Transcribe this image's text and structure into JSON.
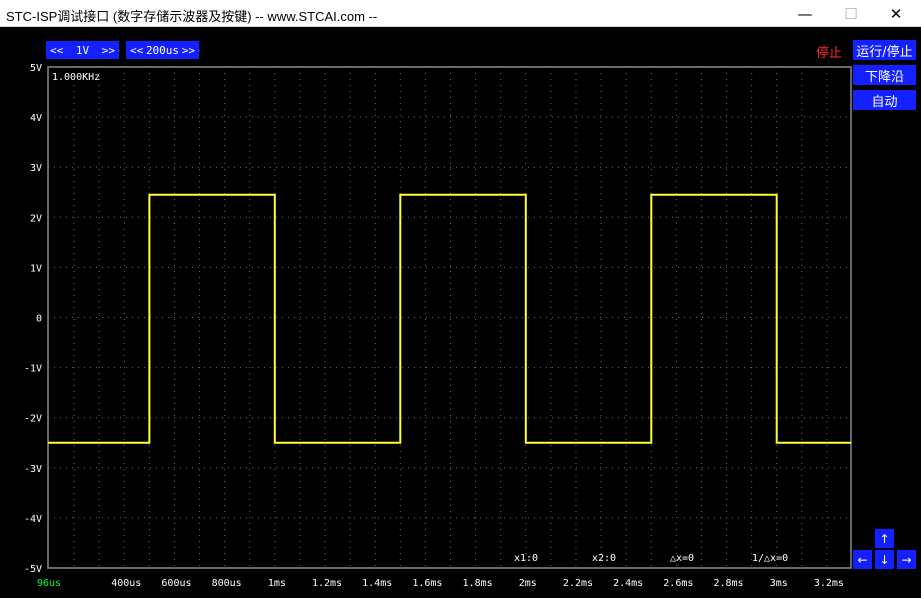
{
  "window": {
    "title": "STC-ISP调试接口 (数字存储示波器及按键) -- www.STCAI.com --",
    "minimize_icon": "minimize-icon",
    "maximize_icon": "maximize-icon",
    "close_icon": "close-icon"
  },
  "toolbar": {
    "volt_prev": "<<",
    "volt_value": "1V",
    "volt_next": ">>",
    "time_prev": "<<",
    "time_value": "200us",
    "time_next": ">>"
  },
  "status": {
    "state": "停止"
  },
  "side_buttons": {
    "run_stop": "运行/停止",
    "trigger_edge": "下降沿",
    "auto": "自动"
  },
  "arrows": {
    "up": "↑",
    "left": "←",
    "down": "↓",
    "right": "→"
  },
  "scope": {
    "frequency": "1.000KHz",
    "cursor_x1": "x1:0",
    "cursor_x2": "x2:0",
    "delta_x": "△x=0",
    "inv_delta_x": "1/△x=0",
    "x_start_label": "96us",
    "colors": {
      "trace": "#ffff33",
      "grid": "#6a6a6a",
      "border": "#8a8a8a",
      "start_label": "#00ff40"
    }
  },
  "chart_data": {
    "type": "line",
    "y_ticks": [
      "5V",
      "4V",
      "3V",
      "2V",
      "1V",
      "0",
      "-1V",
      "-2V",
      "-3V",
      "-4V",
      "-5V"
    ],
    "x_ticks": [
      "400us",
      "600us",
      "800us",
      "1ms",
      "1.2ms",
      "1.4ms",
      "1.6ms",
      "1.8ms",
      "2ms",
      "2.2ms",
      "2.4ms",
      "2.6ms",
      "2.8ms",
      "3ms",
      "3.2ms"
    ],
    "xlim_us": [
      96,
      3296
    ],
    "ylim_v": [
      -5,
      5
    ],
    "series": [
      {
        "x_us": [
          96,
          500,
          500,
          1000,
          1000,
          1500,
          1500,
          2000,
          2000,
          2500,
          2500,
          3000,
          3000,
          3296
        ],
        "y_v": [
          -2.5,
          -2.5,
          2.45,
          2.45,
          -2.5,
          -2.5,
          2.45,
          2.45,
          -2.5,
          -2.5,
          2.45,
          2.45,
          -2.5,
          -2.5
        ]
      }
    ]
  }
}
